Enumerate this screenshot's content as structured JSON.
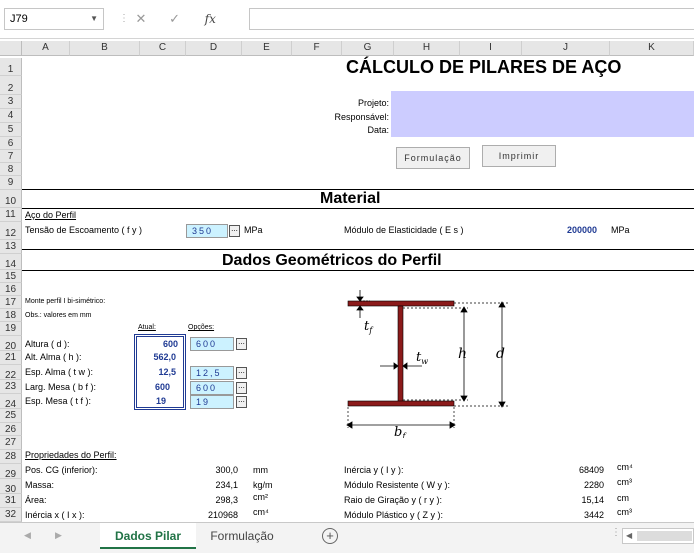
{
  "formula_bar": {
    "name_box": "J79",
    "cancel_icon": "✕",
    "enter_icon": "✓",
    "fx_label": "fx",
    "formula": ""
  },
  "columns": [
    "A",
    "B",
    "C",
    "D",
    "E",
    "F",
    "G",
    "H",
    "I",
    "J",
    "K"
  ],
  "rows": [
    "1",
    "2",
    "3",
    "4",
    "5",
    "6",
    "7",
    "8",
    "9",
    "10",
    "11",
    "12",
    "13",
    "14",
    "15",
    "16",
    "17",
    "18",
    "19",
    "20",
    "21",
    "22",
    "23",
    "24",
    "25",
    "26",
    "27",
    "28",
    "29",
    "30",
    "31",
    "32"
  ],
  "sheet": {
    "title": "CÁLCULO DE PILARES DE AÇO",
    "projeto_label": "Projeto:",
    "responsavel_label": "Responsável:",
    "data_label": "Data:",
    "btn_formulacao": "Formulação",
    "btn_imprimir": "Imprimir",
    "material_heading": "Material",
    "aco_do_perfil": "Aço do Perfil",
    "tensao_label": "Tensão de Escoamento ( f  y )",
    "tensao_value": "350",
    "mpa1": "MPa",
    "modulo_elast_label": "Módulo de Elasticidade ( E  s )",
    "modulo_elast_value": "200000",
    "mpa2": "MPa",
    "dados_heading": "Dados Geométricos do Perfil",
    "monte_perfil": "Monte perfil I bi-simétrico:",
    "obs": "Obs.: valores em mm",
    "atual_header": "Atual:",
    "opcoes_header": "Opções:",
    "altura_label": "Altura ( d ):",
    "alt_alma_label": "Alt. Alma ( h ):",
    "esp_alma_label": "Esp. Alma ( t w ):",
    "larg_mesa_label": "Larg. Mesa ( b f ):",
    "esp_mesa_label": "Esp. Mesa ( t f ):",
    "atual_values": [
      "600",
      "562,0",
      "12,5",
      "600",
      "19"
    ],
    "opcoes_values": {
      "altura": "600",
      "esp_alma": "12,5",
      "larg_mesa": "600",
      "esp_mesa": "19"
    },
    "props_heading": "Propriedades do Perfil:",
    "left_props": [
      {
        "label": "Pos. CG (inferior):",
        "value": "300,0",
        "unit": "mm"
      },
      {
        "label": "Massa:",
        "value": "234,1",
        "unit": "kg/m"
      },
      {
        "label": "Área:",
        "value": "298,3",
        "unit": "cm²"
      },
      {
        "label": "Inércia x ( I x ):",
        "value": "210968",
        "unit": "cm⁴"
      }
    ],
    "right_props": [
      {
        "label": "Inércia y ( I y ):",
        "value": "68409",
        "unit": "cm⁴"
      },
      {
        "label": "Módulo Resistente ( W y ):",
        "value": "2280",
        "unit": "cm³"
      },
      {
        "label": "Raio de Giração y ( r y ):",
        "value": "15,14",
        "unit": "cm"
      },
      {
        "label": "Módulo Plástico y ( Z y ):",
        "value": "3442",
        "unit": "cm³"
      }
    ]
  },
  "diagram": {
    "t_f": "t",
    "t_f_sub": "f",
    "t_w": "t",
    "t_w_sub": "w",
    "h": "h",
    "d": "d",
    "b_f": "b",
    "b_f_sub": "f"
  },
  "tabs": [
    "Dados Pilar",
    "Formulação"
  ],
  "colors": {
    "flange": "#8b1a1a",
    "input_blue": "#ccf2ff",
    "project_fill": "#ccccff",
    "accent_green": "#217346"
  }
}
